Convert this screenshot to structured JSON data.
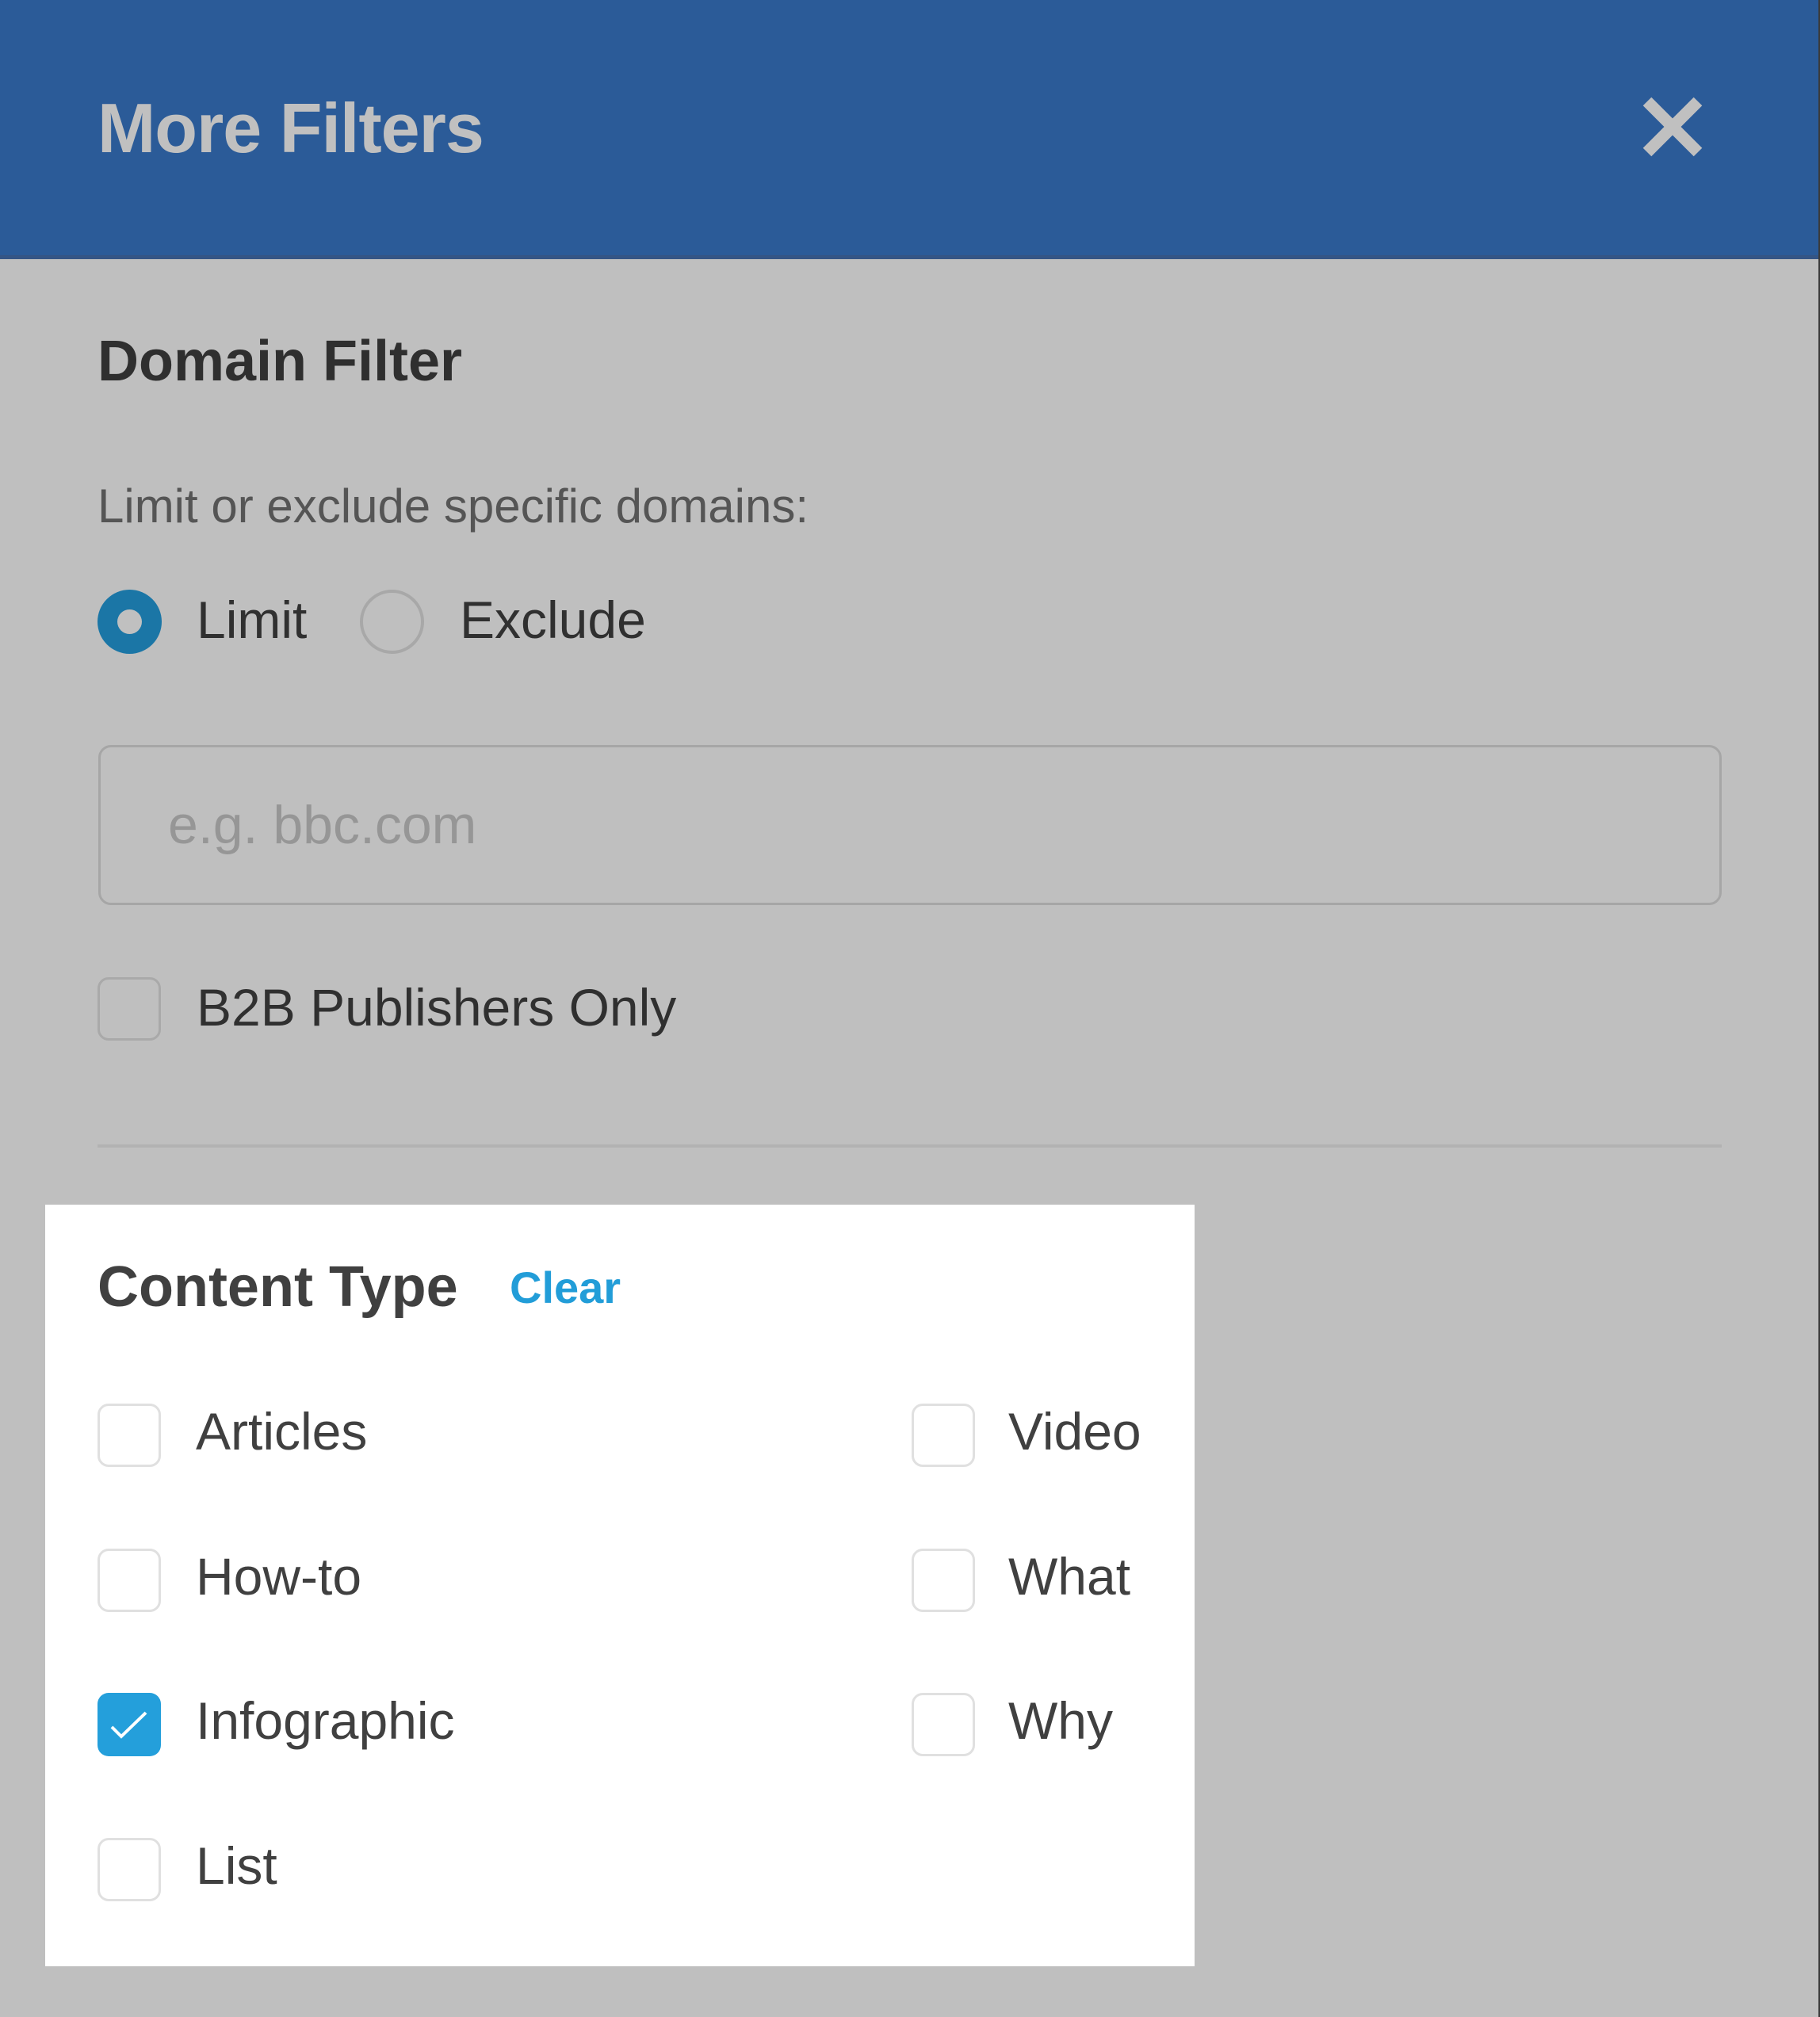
{
  "header": {
    "title": "More Filters",
    "close_icon": "close-icon",
    "background_color": "#2b5b98"
  },
  "domain_filter": {
    "title": "Domain Filter",
    "subtitle": "Limit or exclude specific domains:",
    "mode_options": [
      {
        "label": "Limit",
        "selected": true
      },
      {
        "label": "Exclude",
        "selected": false
      }
    ],
    "domain_input": {
      "value": "",
      "placeholder": "e.g. bbc.com"
    },
    "b2b_checkbox": {
      "label": "B2B Publishers Only",
      "checked": false
    },
    "radio_color": "#1b76a6"
  },
  "content_type": {
    "title": "Content Type",
    "clear_label": "Clear",
    "accent_color": "#229dd8",
    "options_left": [
      {
        "label": "Articles",
        "checked": false
      },
      {
        "label": "How-to",
        "checked": false
      },
      {
        "label": "Infographic",
        "checked": true
      },
      {
        "label": "List",
        "checked": false
      }
    ],
    "options_right": [
      {
        "label": "Video",
        "checked": false
      },
      {
        "label": "What",
        "checked": false
      },
      {
        "label": "Why",
        "checked": false
      }
    ]
  }
}
